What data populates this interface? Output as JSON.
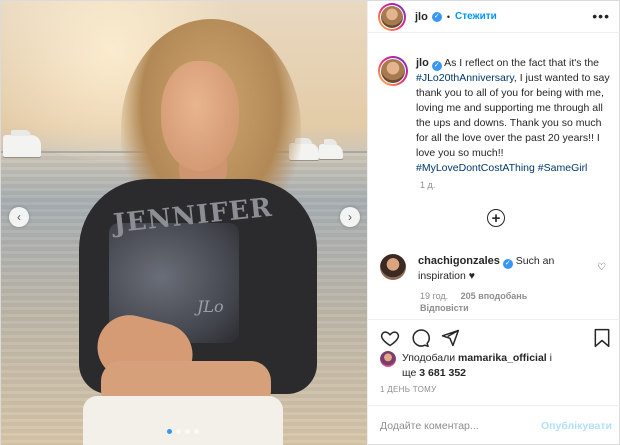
{
  "header": {
    "username": "jlo",
    "separator": "•",
    "follow_label": "Стежити",
    "more_label": "•••"
  },
  "caption": {
    "username": "jlo",
    "text_1": "As I reflect on the fact that it's the",
    "hashtag_1": "#JLo20thAnniversary",
    "text_2": ", I just wanted to say thank you to all of you for being with me, loving me and supporting me through all the ups and downs. Thank you so much for all the love over the past 20 years!! I love you so much!!",
    "hashtag_2": "#MyLoveDontCostAThing",
    "hashtag_3": "#SameGirl",
    "time": "1 д."
  },
  "load_more": "+",
  "comment": {
    "username": "chachigonzales",
    "text": "Such an inspiration",
    "emoji": "♥",
    "time": "19 год.",
    "likes": "205 вподобань",
    "reply": "Відповісти",
    "heart": "♡"
  },
  "likes_line": {
    "prefix": "Уподобали",
    "user": "mamarika_official",
    "connector": "і",
    "rest_prefix": "ще",
    "count": "3 681 352"
  },
  "date_label": "1 ДЕНЬ ТОМУ",
  "comment_input": {
    "placeholder": "Додайте коментар...",
    "value": ""
  },
  "publish_label": "Опублікувати",
  "carousel": {
    "prev": "‹",
    "next": "›",
    "slides": 4,
    "active_slide": 1,
    "print_text": "JENNIFER",
    "signature": "JLo"
  },
  "colors": {
    "link_blue": "#0095f6",
    "hashtag": "#00376b",
    "muted": "#8e8e8e",
    "publish_disabled": "#b2dffc"
  }
}
